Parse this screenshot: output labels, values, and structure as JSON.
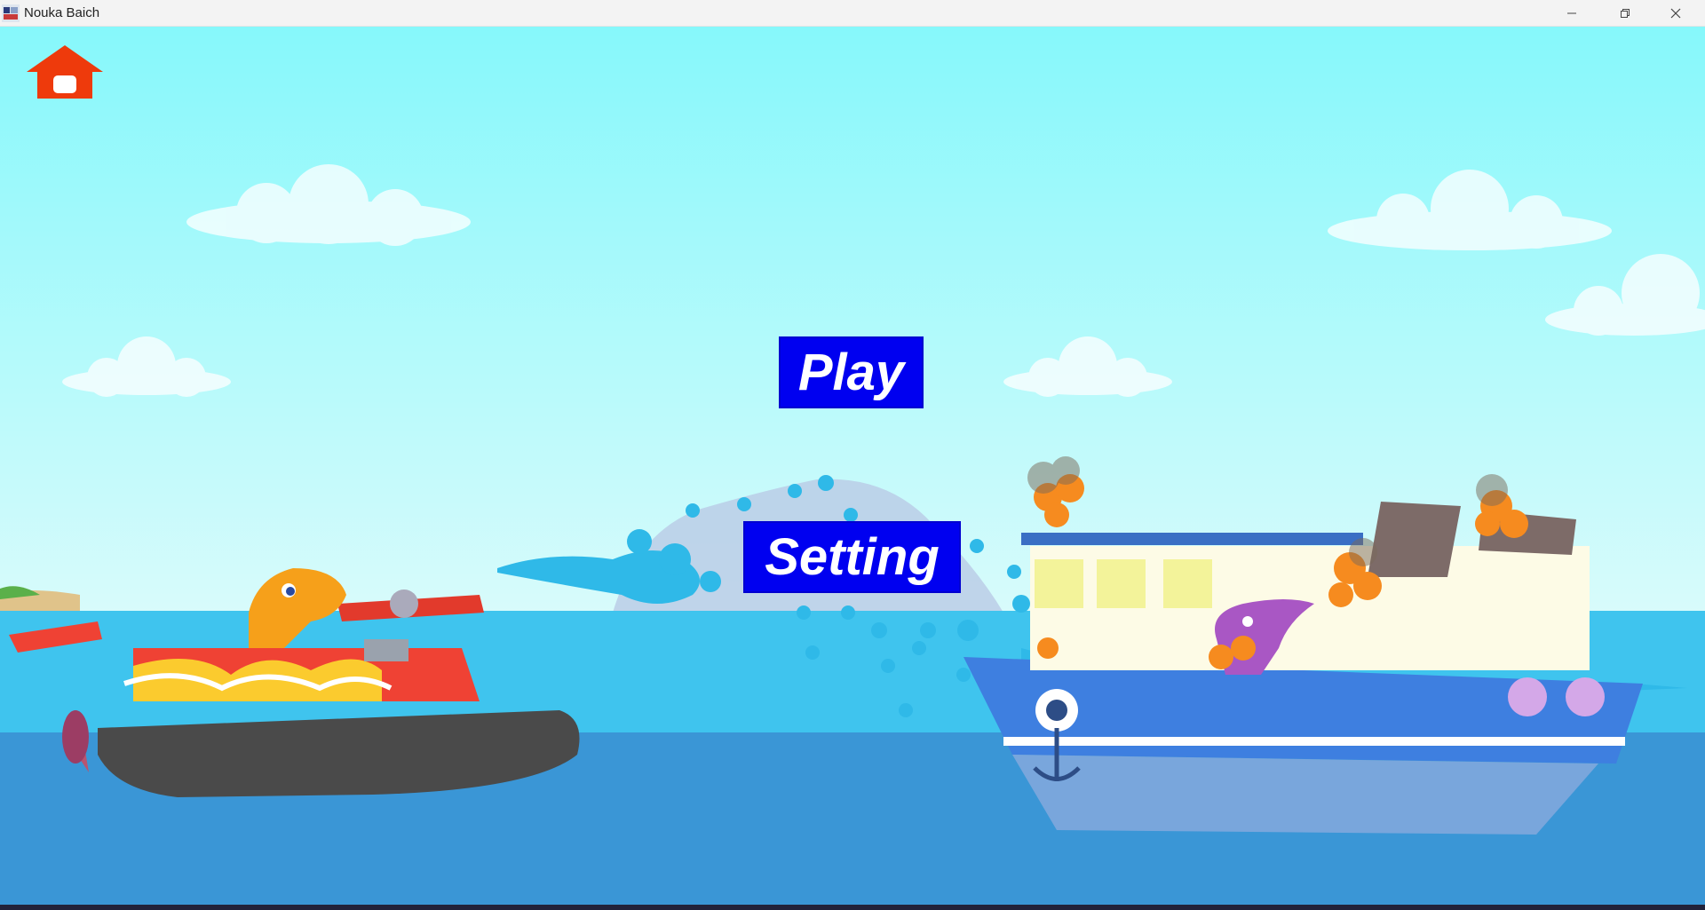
{
  "window": {
    "title": "Nouka Baich",
    "app_icon": "boat-app-icon",
    "controls": [
      "minimize-icon",
      "restore-icon",
      "close-icon"
    ]
  },
  "menu": {
    "play_label": "Play",
    "setting_label": "Setting"
  },
  "home_icon": "home-icon",
  "colors": {
    "sky_top": "#86f8fb",
    "sky_bottom": "#d8fbfb",
    "sea": "#3fc4ee",
    "sea_deep": "#3a96d6",
    "button_bg": "#0000f0",
    "button_text": "#ffffff",
    "home_icon": "#ee3a0c"
  }
}
